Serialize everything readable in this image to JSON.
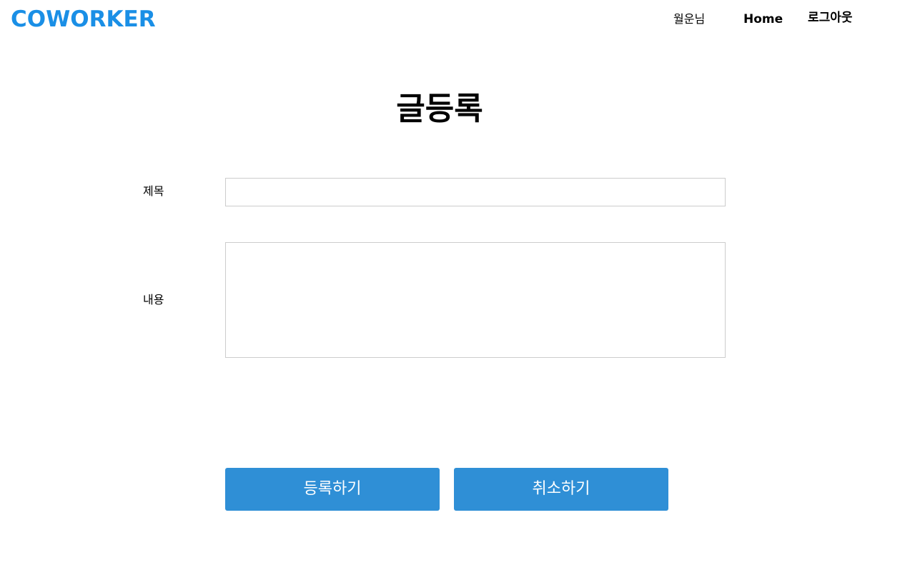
{
  "header": {
    "brand": "COWORKER",
    "user_label": "월운님",
    "home_label": "Home",
    "logout_label": "로그아웃"
  },
  "main": {
    "title": "글등록",
    "form": {
      "title_label": "제목",
      "title_value": "",
      "content_label": "내용",
      "content_value": ""
    },
    "buttons": {
      "submit_label": "등록하기",
      "cancel_label": "취소하기"
    }
  },
  "colors": {
    "brand": "#1a8fe6",
    "button": "#2f8fd6",
    "button_text": "#ffffff",
    "input_border": "#cccccc"
  }
}
